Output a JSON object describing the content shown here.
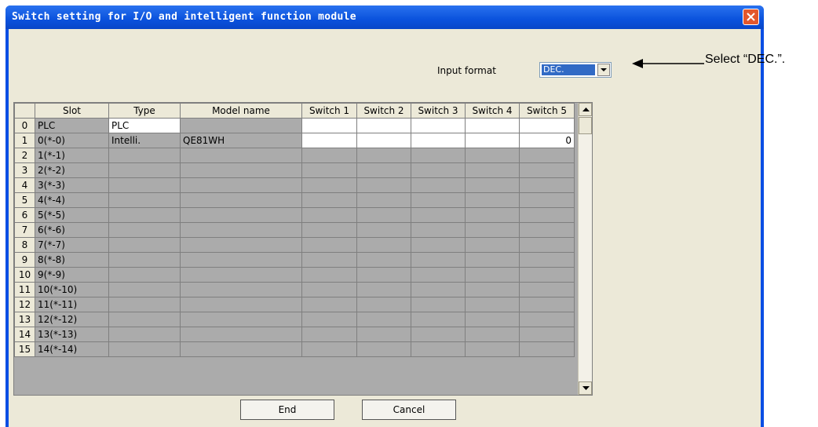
{
  "window": {
    "title": "Switch setting for I/O and intelligent function module"
  },
  "input_format": {
    "label": "Input format",
    "value": "DEC."
  },
  "grid": {
    "columns": [
      "",
      "Slot",
      "Type",
      "Model name",
      "Switch 1",
      "Switch 2",
      "Switch 3",
      "Switch 4",
      "Switch 5"
    ],
    "rows": [
      {
        "num": "0",
        "slot": "PLC",
        "type": "PLC",
        "model": "",
        "s1": "",
        "s2": "",
        "s3": "",
        "s4": "",
        "s5": ""
      },
      {
        "num": "1",
        "slot": "0(*-0)",
        "type": "Intelli.",
        "model": "QE81WH",
        "s1": "",
        "s2": "",
        "s3": "",
        "s4": "",
        "s5": "0"
      },
      {
        "num": "2",
        "slot": "1(*-1)",
        "type": "",
        "model": "",
        "s1": "",
        "s2": "",
        "s3": "",
        "s4": "",
        "s5": ""
      },
      {
        "num": "3",
        "slot": "2(*-2)",
        "type": "",
        "model": "",
        "s1": "",
        "s2": "",
        "s3": "",
        "s4": "",
        "s5": ""
      },
      {
        "num": "4",
        "slot": "3(*-3)",
        "type": "",
        "model": "",
        "s1": "",
        "s2": "",
        "s3": "",
        "s4": "",
        "s5": ""
      },
      {
        "num": "5",
        "slot": "4(*-4)",
        "type": "",
        "model": "",
        "s1": "",
        "s2": "",
        "s3": "",
        "s4": "",
        "s5": ""
      },
      {
        "num": "6",
        "slot": "5(*-5)",
        "type": "",
        "model": "",
        "s1": "",
        "s2": "",
        "s3": "",
        "s4": "",
        "s5": ""
      },
      {
        "num": "7",
        "slot": "6(*-6)",
        "type": "",
        "model": "",
        "s1": "",
        "s2": "",
        "s3": "",
        "s4": "",
        "s5": ""
      },
      {
        "num": "8",
        "slot": "7(*-7)",
        "type": "",
        "model": "",
        "s1": "",
        "s2": "",
        "s3": "",
        "s4": "",
        "s5": ""
      },
      {
        "num": "9",
        "slot": "8(*-8)",
        "type": "",
        "model": "",
        "s1": "",
        "s2": "",
        "s3": "",
        "s4": "",
        "s5": ""
      },
      {
        "num": "10",
        "slot": "9(*-9)",
        "type": "",
        "model": "",
        "s1": "",
        "s2": "",
        "s3": "",
        "s4": "",
        "s5": ""
      },
      {
        "num": "11",
        "slot": "10(*-10)",
        "type": "",
        "model": "",
        "s1": "",
        "s2": "",
        "s3": "",
        "s4": "",
        "s5": ""
      },
      {
        "num": "12",
        "slot": "11(*-11)",
        "type": "",
        "model": "",
        "s1": "",
        "s2": "",
        "s3": "",
        "s4": "",
        "s5": ""
      },
      {
        "num": "13",
        "slot": "12(*-12)",
        "type": "",
        "model": "",
        "s1": "",
        "s2": "",
        "s3": "",
        "s4": "",
        "s5": ""
      },
      {
        "num": "14",
        "slot": "13(*-13)",
        "type": "",
        "model": "",
        "s1": "",
        "s2": "",
        "s3": "",
        "s4": "",
        "s5": ""
      },
      {
        "num": "15",
        "slot": "14(*-14)",
        "type": "",
        "model": "",
        "s1": "",
        "s2": "",
        "s3": "",
        "s4": "",
        "s5": ""
      }
    ]
  },
  "buttons": {
    "end": "End",
    "cancel": "Cancel"
  },
  "annotation": {
    "text": "Select “DEC.”."
  },
  "icons": {
    "close": "close-icon",
    "dropdown": "chevron-down-icon",
    "scroll_up": "scroll-up-icon",
    "scroll_down": "scroll-down-icon",
    "annotation_arrow": "arrow-left-icon"
  },
  "colors": {
    "titlebar": "#0a52dd",
    "dialog_bg": "#ece9d8",
    "grid_inactive": "#ababab",
    "selection": "#316ac5",
    "close": "#e3572c"
  }
}
